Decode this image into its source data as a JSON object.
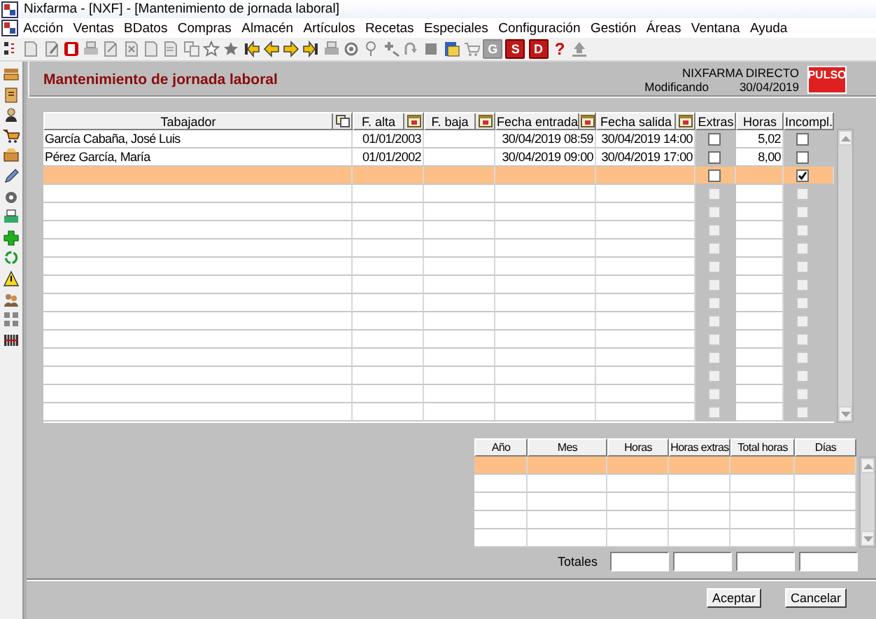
{
  "window": {
    "title": "Nixfarma - [NXF] - [Mantenimiento de jornada laboral]"
  },
  "menu": [
    "Acción",
    "Ventas",
    "BDatos",
    "Compras",
    "Almacén",
    "Artículos",
    "Recetas",
    "Especiales",
    "Configuración",
    "Gestión",
    "Áreas",
    "Ventana",
    "Ayuda"
  ],
  "toolbar": {
    "letter_buttons": [
      {
        "label": "G",
        "kind": "tile",
        "disabled": true
      },
      {
        "label": "S",
        "kind": "tile",
        "disabled": false
      },
      {
        "label": "D",
        "kind": "tile",
        "disabled": false
      },
      {
        "label": "?",
        "kind": "plain",
        "disabled": false
      }
    ]
  },
  "form": {
    "title": "Mantenimiento de jornada laboral",
    "brand": "NIXFARMA DIRECTO",
    "mode": "Modificando",
    "date": "30/04/2019",
    "logo": "PULSO"
  },
  "table": {
    "columns": [
      {
        "label": "Tabajador",
        "kind": "copy"
      },
      {
        "label": "F. alta",
        "kind": "calendar"
      },
      {
        "label": "F. baja",
        "kind": "calendar"
      },
      {
        "label": "Fecha entrada",
        "kind": "calendar"
      },
      {
        "label": "Fecha salida",
        "kind": "calendar"
      },
      {
        "label": "Extras",
        "kind": "plain"
      },
      {
        "label": "Horas",
        "kind": "plain"
      },
      {
        "label": "Incompl.",
        "kind": "plain"
      }
    ],
    "rows": [
      {
        "trabajador": "García Cabaña, José Luis",
        "f_alta": "01/01/2003",
        "fecha_entrada": "30/04/2019 08:59",
        "fecha_salida": "30/04/2019 14:00",
        "extras": false,
        "horas": "5,02",
        "incompl": false,
        "selected": false,
        "disabled": false
      },
      {
        "trabajador": "Pérez García, María",
        "f_alta": "01/01/2002",
        "fecha_entrada": "30/04/2019 09:00",
        "fecha_salida": "30/04/2019 17:00",
        "extras": false,
        "horas": "8,00",
        "incompl": false,
        "selected": false,
        "disabled": false
      },
      {
        "extras": false,
        "incompl": true,
        "selected": true,
        "disabled": false
      },
      {
        "extras": false,
        "incompl": false,
        "selected": false,
        "disabled": true
      },
      {
        "extras": false,
        "incompl": false,
        "selected": false,
        "disabled": true
      },
      {
        "extras": false,
        "incompl": false,
        "selected": false,
        "disabled": true
      },
      {
        "extras": false,
        "incompl": false,
        "selected": false,
        "disabled": true
      },
      {
        "extras": false,
        "incompl": false,
        "selected": false,
        "disabled": true
      },
      {
        "extras": false,
        "incompl": false,
        "selected": false,
        "disabled": true
      },
      {
        "extras": false,
        "incompl": false,
        "selected": false,
        "disabled": true
      },
      {
        "extras": false,
        "incompl": false,
        "selected": false,
        "disabled": true
      },
      {
        "extras": false,
        "incompl": false,
        "selected": false,
        "disabled": true
      },
      {
        "extras": false,
        "incompl": false,
        "selected": false,
        "disabled": true
      },
      {
        "extras": false,
        "incompl": false,
        "selected": false,
        "disabled": true
      },
      {
        "extras": false,
        "incompl": false,
        "selected": false,
        "disabled": true
      },
      {
        "extras": false,
        "incompl": false,
        "selected": false,
        "disabled": true
      }
    ]
  },
  "summary": {
    "columns": [
      "Año",
      "Mes",
      "Horas",
      "Horas extras",
      "Total horas",
      "Días"
    ],
    "rows": [
      {
        "selected": true
      },
      {
        "selected": false
      },
      {
        "selected": false
      },
      {
        "selected": false
      },
      {
        "selected": false
      }
    ],
    "totals_label": "Totales"
  },
  "buttons": [
    "Aceptar",
    "Cancelar"
  ]
}
